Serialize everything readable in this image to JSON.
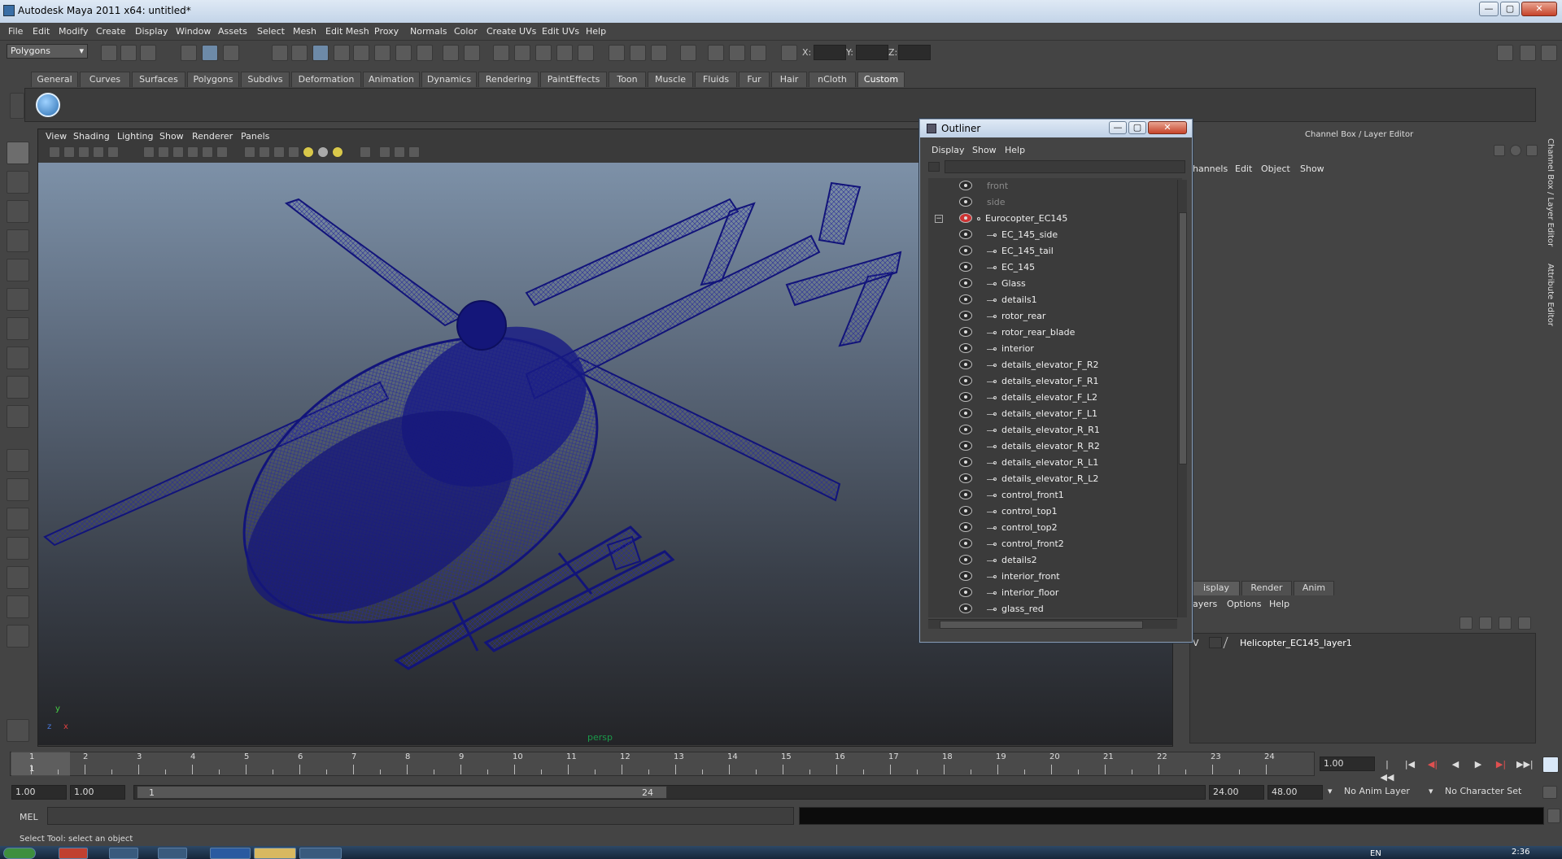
{
  "window": {
    "title": "Autodesk Maya 2011 x64: untitled*",
    "controls": {
      "minimize": "—",
      "maximize": "▢",
      "close": "✕"
    }
  },
  "menubar": [
    "File",
    "Edit",
    "Modify",
    "Create",
    "Display",
    "Window",
    "Assets",
    "Select",
    "Mesh",
    "Edit Mesh",
    "Proxy",
    "Normals",
    "Color",
    "Create UVs",
    "Edit UVs",
    "Help"
  ],
  "statusline": {
    "mode": "Polygons",
    "x_label": "X:",
    "y_label": "Y:",
    "z_label": "Z:"
  },
  "shelf": {
    "tabs": [
      "General",
      "Curves",
      "Surfaces",
      "Polygons",
      "Subdivs",
      "Deformation",
      "Animation",
      "Dynamics",
      "Rendering",
      "PaintEffects",
      "Toon",
      "Muscle",
      "Fluids",
      "Fur",
      "Hair",
      "nCloth",
      "Custom"
    ],
    "active_tab": "Custom"
  },
  "viewport": {
    "menu": [
      "View",
      "Shading",
      "Lighting",
      "Show",
      "Renderer",
      "Panels"
    ],
    "camera_label": "persp",
    "axis_y": "y",
    "axis_z": "z",
    "axis_x": "x",
    "wireframe_color": "#12147a"
  },
  "outliner": {
    "title": "Outliner",
    "menu": [
      "Display",
      "Show",
      "Help"
    ],
    "items": [
      {
        "label": "front",
        "kind": "camera",
        "depth": 0,
        "dim": true
      },
      {
        "label": "side",
        "kind": "camera",
        "depth": 0,
        "dim": true
      },
      {
        "label": "Eurocopter_EC145",
        "kind": "group",
        "depth": 0,
        "expanded": "−"
      },
      {
        "label": "EC_145_side",
        "depth": 1
      },
      {
        "label": "EC_145_tail",
        "depth": 1
      },
      {
        "label": "EC_145",
        "depth": 1
      },
      {
        "label": "Glass",
        "depth": 1
      },
      {
        "label": "details1",
        "depth": 1
      },
      {
        "label": "rotor_rear",
        "depth": 1
      },
      {
        "label": "rotor_rear_blade",
        "depth": 1
      },
      {
        "label": "interior",
        "depth": 1
      },
      {
        "label": "details_elevator_F_R2",
        "depth": 1
      },
      {
        "label": "details_elevator_F_R1",
        "depth": 1
      },
      {
        "label": "details_elevator_F_L2",
        "depth": 1
      },
      {
        "label": "details_elevator_F_L1",
        "depth": 1
      },
      {
        "label": "details_elevator_R_R1",
        "depth": 1
      },
      {
        "label": "details_elevator_R_R2",
        "depth": 1
      },
      {
        "label": "details_elevator_R_L1",
        "depth": 1
      },
      {
        "label": "details_elevator_R_L2",
        "depth": 1
      },
      {
        "label": "control_front1",
        "depth": 1
      },
      {
        "label": "control_top1",
        "depth": 1
      },
      {
        "label": "control_top2",
        "depth": 1
      },
      {
        "label": "control_front2",
        "depth": 1
      },
      {
        "label": "details2",
        "depth": 1
      },
      {
        "label": "interior_front",
        "depth": 1
      },
      {
        "label": "interior_floor",
        "depth": 1
      },
      {
        "label": "glass_red",
        "depth": 1
      }
    ]
  },
  "channel_box": {
    "title": "Channel Box / Layer Editor",
    "menu": [
      "hannels",
      "Edit",
      "Object",
      "Show"
    ],
    "side_tabs": [
      "Channel Box / Layer Editor",
      "Attribute Editor"
    ]
  },
  "layer_editor": {
    "tabs": [
      "isplay",
      "Render",
      "Anim"
    ],
    "active_tab": "isplay",
    "menu": [
      "ayers",
      "Options",
      "Help"
    ],
    "layers": [
      {
        "visible": "V",
        "name": "Helicopter_EC145_layer1"
      }
    ]
  },
  "timeline": {
    "ticks": [
      "1",
      "2",
      "3",
      "4",
      "5",
      "6",
      "7",
      "8",
      "9",
      "10",
      "11",
      "12",
      "13",
      "14",
      "15",
      "16",
      "17",
      "18",
      "19",
      "20",
      "21",
      "22",
      "23",
      "24"
    ],
    "current_frame": "1",
    "current_time_field": "1.00",
    "playback": [
      "|◀◀",
      "|◀",
      "◀|",
      "◀",
      "▶",
      "▶|",
      "▶▶|"
    ]
  },
  "range": {
    "start_outer": "1.00",
    "start_inner": "1.00",
    "range_start_label": "1",
    "range_end_label": "24",
    "end_inner": "24.00",
    "end_outer": "48.00",
    "anim_layer": "No Anim Layer",
    "character_set": "No Character Set"
  },
  "command": {
    "label": "MEL",
    "help_text": "Select Tool: select an object"
  },
  "taskbar": {
    "lang": "EN",
    "clock": "2:36"
  }
}
